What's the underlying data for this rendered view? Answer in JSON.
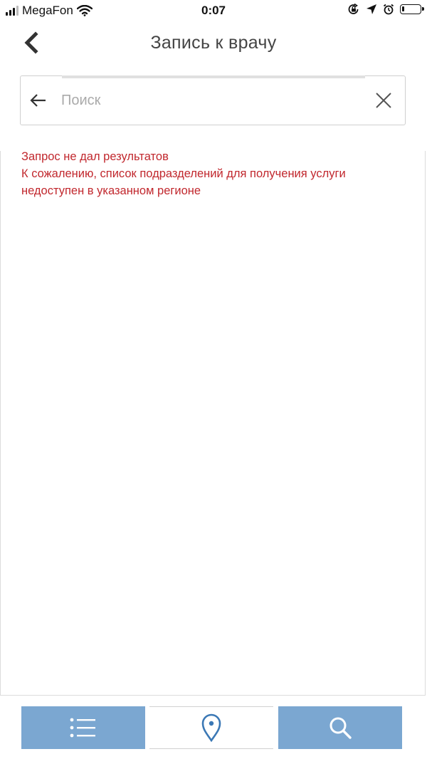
{
  "status_bar": {
    "carrier": "MegaFon",
    "time": "0:07",
    "battery_level": 0.15
  },
  "header": {
    "title": "Запись к врачу",
    "back_icon": "chevron-left-icon"
  },
  "search": {
    "placeholder": "Поиск",
    "value": "",
    "back_icon": "arrow-left-icon",
    "clear_icon": "close-icon"
  },
  "results": {
    "lines": [
      "Запрос не дал результатов",
      "К сожалению, список подразделений для получения услуги",
      "недоступен в указанном регионе"
    ],
    "color": "#c1272d"
  },
  "bottom_bar": {
    "tabs": [
      {
        "icon": "list-icon",
        "active": true
      },
      {
        "icon": "map-pin-icon",
        "active": false
      },
      {
        "icon": "search-icon",
        "active": true
      }
    ],
    "active_color": "#7ba7d1",
    "map_icon_color": "#3b78b5"
  }
}
